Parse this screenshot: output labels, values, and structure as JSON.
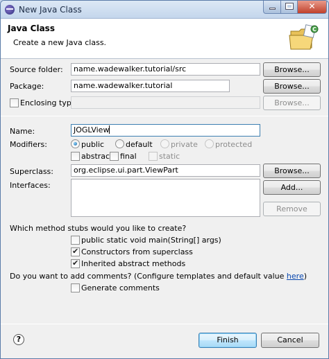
{
  "window": {
    "title": "New Java Class",
    "min_glyph": "–",
    "max_glyph": "□",
    "close_glyph": "✕"
  },
  "banner": {
    "title": "Java Class",
    "description": "Create a new Java class.",
    "icon": "java-class-folder-icon"
  },
  "source_folder": {
    "label": "Source folder:",
    "value": "name.wadewalker.tutorial/src",
    "browse_label": "Browse..."
  },
  "package": {
    "label": "Package:",
    "value": "name.wadewalker.tutorial",
    "browse_label": "Browse..."
  },
  "enclosing_type": {
    "label": "Enclosing type:",
    "checked": false,
    "value": "",
    "browse_label": "Browse..."
  },
  "name": {
    "label": "Name:",
    "value": "JOGLView"
  },
  "modifiers": {
    "label": "Modifiers:",
    "visibility": [
      "public",
      "default",
      "private",
      "protected"
    ],
    "selected": "public",
    "flags": [
      "abstract",
      "final",
      "static"
    ]
  },
  "superclass": {
    "label": "Superclass:",
    "value": "org.eclipse.ui.part.ViewPart",
    "browse_label": "Browse..."
  },
  "interfaces": {
    "label": "Interfaces:",
    "add_label": "Add...",
    "remove_label": "Remove"
  },
  "method_stubs": {
    "question": "Which method stubs would you like to create?",
    "options": [
      {
        "label": "public static void main(String[] args)",
        "checked": false
      },
      {
        "label": "Constructors from superclass",
        "checked": true
      },
      {
        "label": "Inherited abstract methods",
        "checked": true
      }
    ]
  },
  "comments": {
    "question": "Do you want to add comments? (Configure templates and default value ",
    "link": "here",
    "end": ")",
    "generate_label": "Generate comments",
    "checked": false
  },
  "footer": {
    "help_glyph": "?",
    "finish_label": "Finish",
    "cancel_label": "Cancel"
  }
}
